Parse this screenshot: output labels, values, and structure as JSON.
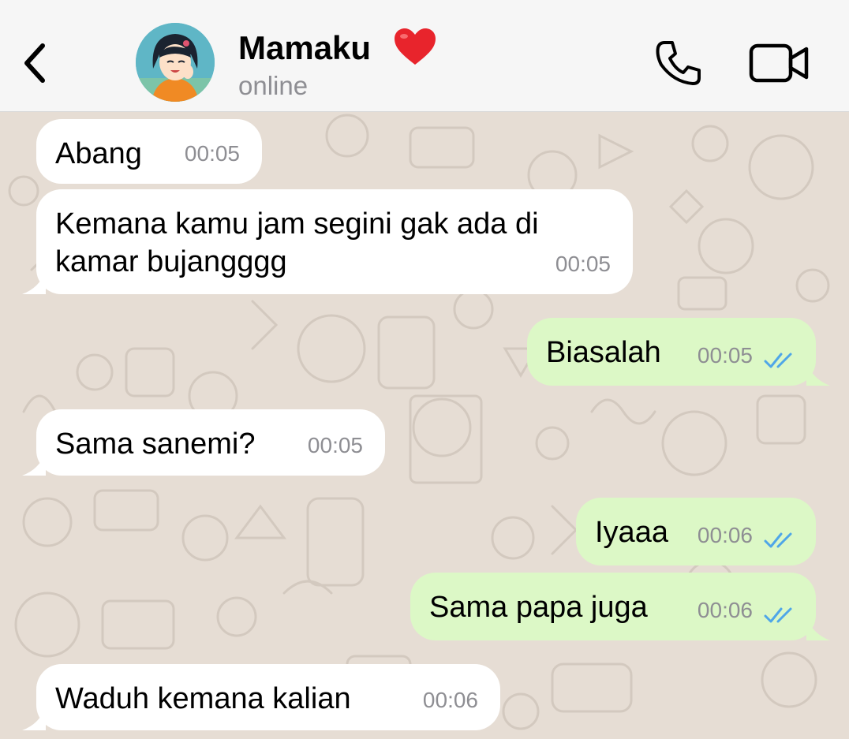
{
  "header": {
    "contact_name": "Mamaku",
    "status": "online",
    "back_icon": "chevron-left-icon",
    "call_icon": "phone-icon",
    "video_icon": "video-camera-icon",
    "name_emoji": "red-heart"
  },
  "colors": {
    "incoming_bubble": "#ffffff",
    "outgoing_bubble": "#dcf8c6",
    "read_ticks": "#4fa6e8",
    "timestamp": "#8e8e93",
    "wallpaper": "#e6ddd4"
  },
  "messages": [
    {
      "direction": "incoming",
      "lines": [
        "Abang"
      ],
      "time": "00:05"
    },
    {
      "direction": "incoming",
      "lines": [
        "Kemana kamu jam segini gak ada di",
        "kamar bujangggg"
      ],
      "time": "00:05"
    },
    {
      "direction": "outgoing",
      "lines": [
        "Biasalah"
      ],
      "time": "00:05",
      "status": "read"
    },
    {
      "direction": "incoming",
      "lines": [
        "Sama sanemi?"
      ],
      "time": "00:05"
    },
    {
      "direction": "outgoing",
      "lines": [
        "Iyaaa"
      ],
      "time": "00:06",
      "status": "read"
    },
    {
      "direction": "outgoing",
      "lines": [
        "Sama papa juga"
      ],
      "time": "00:06",
      "status": "read"
    },
    {
      "direction": "incoming",
      "lines": [
        "Waduh kemana kalian"
      ],
      "time": "00:06"
    }
  ]
}
